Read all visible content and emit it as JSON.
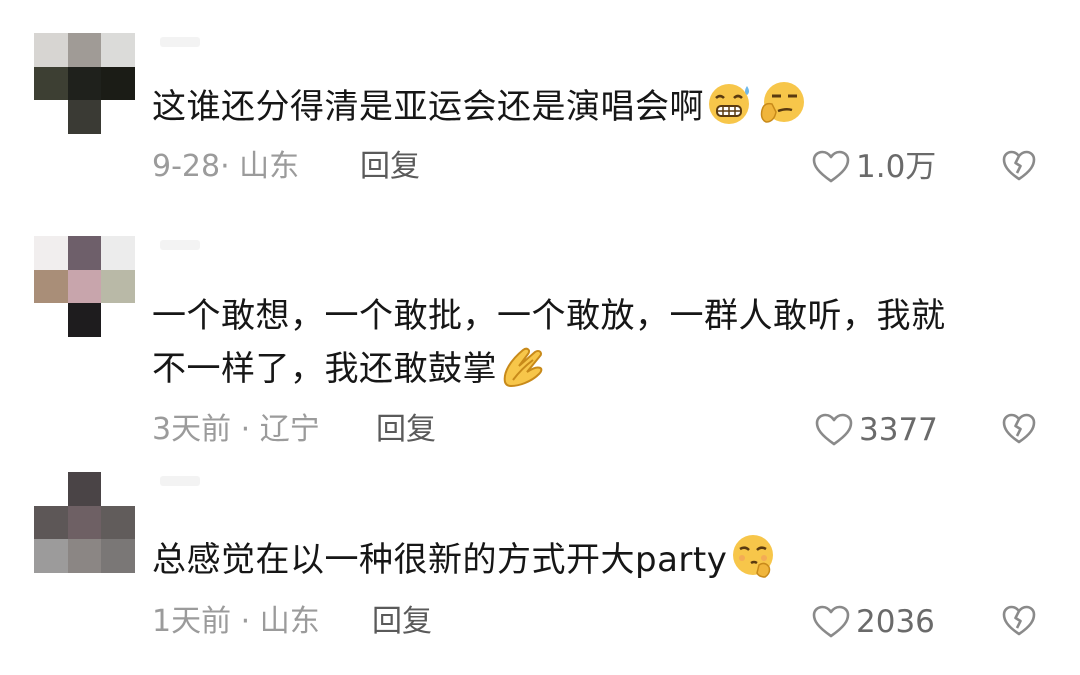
{
  "comments": [
    {
      "text": "这谁还分得清是亚运会还是演唱会啊",
      "emojis": [
        "grimacing-sweat-emoji",
        "smirk-thinking-emoji"
      ],
      "time": "9-28",
      "location": "山东",
      "reply_label": "回复",
      "likes": "1.0万",
      "avatar_colors": [
        "#d7d5d2",
        "#a09b96",
        "#dbdbd9",
        "#3d3f33",
        "#1f211c",
        "#1b1c16",
        "#ffffff",
        "#3a3a34",
        "#ffffff"
      ]
    },
    {
      "text": "一个敢想，一个敢批，一个敢放，一群人敢听，我就\n不一样了，我还敢鼓掌",
      "emojis": [
        "clapping-hands-emoji"
      ],
      "time": "3天前",
      "location": "辽宁",
      "reply_label": "回复",
      "likes": "3377",
      "avatar_colors": [
        "#f1eeee",
        "#6e5f6a",
        "#ececec",
        "#a98e78",
        "#c8a5ac",
        "#b9b9a7",
        "#ffffff",
        "#1e1c1e",
        "#ffffff"
      ]
    },
    {
      "text": "总感觉在以一种很新的方式开大party",
      "emojis": [
        "shushing-face-emoji"
      ],
      "time": "1天前",
      "location": "山东",
      "reply_label": "回复",
      "likes": "2036",
      "avatar_colors": [
        "#ffffff",
        "#4a4446",
        "#ffffff",
        "#5d5757",
        "#6e6064",
        "#615c5b",
        "#9c9b9b",
        "#8b8684",
        "#7a7776"
      ]
    }
  ],
  "colors": {
    "text": "#161616",
    "meta": "#9b9b9b",
    "reply": "#5a5a5a",
    "like_count": "#6a6a6a",
    "icon": "#8a8a8a",
    "emoji_yellow": "#f7c64a"
  }
}
